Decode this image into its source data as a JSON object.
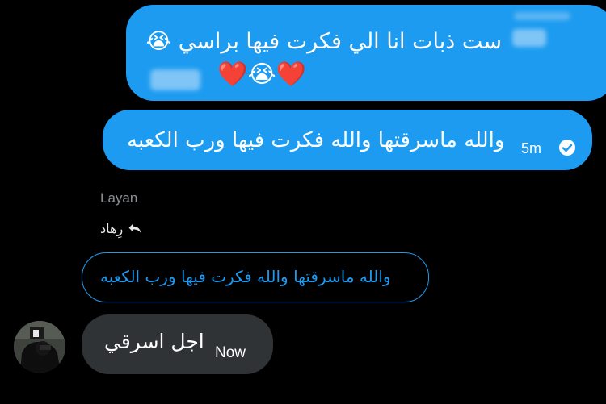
{
  "messages": [
    {
      "line1": "ست ذبات انا الي فكرت فيها براسي 😭",
      "line2": "❤️😭❤️"
    },
    {
      "text": "والله ماسرقتها والله فكرت فيها ورب الكعبه",
      "time": "5m",
      "status_icon": "check-circle-icon"
    }
  ],
  "reply": {
    "sender": "Layan",
    "replying_to": "رِهاد",
    "reply_icon": "reply-arrow-icon",
    "quoted_text": "والله ماسرقتها والله فكرت فيها ورب الكعبه"
  },
  "received": {
    "text": "اجل اسرقي",
    "time": "Now",
    "avatar_icon": "user-avatar"
  },
  "colors": {
    "accent": "#1d9bf0",
    "received_bubble": "#2f3336",
    "background": "#000000",
    "muted": "#8b8f94"
  }
}
